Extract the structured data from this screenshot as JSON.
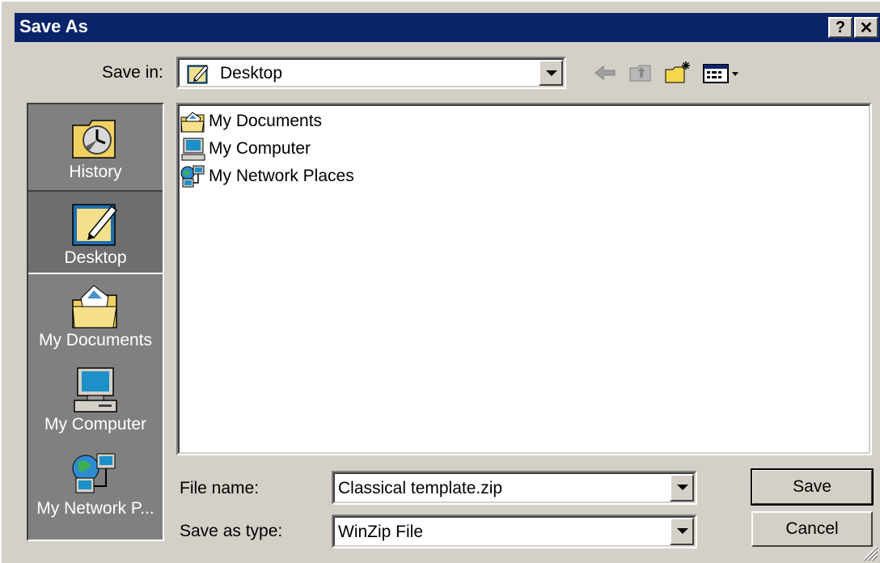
{
  "window": {
    "title": "Save As",
    "help_button": "?",
    "close_button": "✕"
  },
  "toolbar": {
    "save_in_label": "Save in:",
    "save_in_value": "Desktop",
    "back_icon": "back-arrow-icon",
    "up_folder_icon": "up-one-level-icon",
    "new_folder_icon": "new-folder-icon",
    "view_menu_icon": "view-menu-icon"
  },
  "places_bar": {
    "items": [
      {
        "label": "History",
        "icon": "history-icon",
        "selected": false
      },
      {
        "label": "Desktop",
        "icon": "desktop-icon",
        "selected": true
      },
      {
        "label": "My Documents",
        "icon": "my-documents-icon",
        "selected": false
      },
      {
        "label": "My Computer",
        "icon": "my-computer-icon",
        "selected": false
      },
      {
        "label": "My Network P...",
        "icon": "my-network-places-icon",
        "selected": false
      }
    ]
  },
  "file_list": {
    "items": [
      {
        "label": "My Documents",
        "icon": "my-documents-icon"
      },
      {
        "label": "My Computer",
        "icon": "my-computer-icon"
      },
      {
        "label": "My Network Places",
        "icon": "my-network-places-icon"
      }
    ]
  },
  "form": {
    "file_name_label": "File name:",
    "file_name_value": "Classical template.zip",
    "save_as_type_label": "Save as type:",
    "save_as_type_value": "WinZip File"
  },
  "buttons": {
    "save": "Save",
    "cancel": "Cancel"
  },
  "colors": {
    "titlebar": "#0a246a",
    "face": "#d4d0c8",
    "places_bar": "#808080"
  }
}
